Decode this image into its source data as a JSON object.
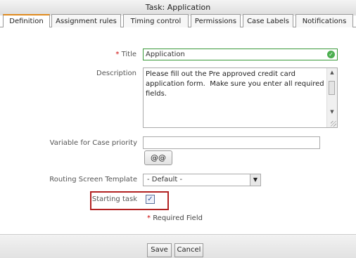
{
  "window": {
    "title": "Task: Application"
  },
  "tabs": [
    {
      "label": "Definition"
    },
    {
      "label": "Assignment rules"
    },
    {
      "label": "Timing control"
    },
    {
      "label": "Permissions"
    },
    {
      "label": "Case Labels"
    },
    {
      "label": "Notifications"
    }
  ],
  "form": {
    "title_label": "Title",
    "title_value": "Application",
    "description_label": "Description",
    "description_value": "Please fill out the Pre approved credit card application form.  Make sure you enter all required fields.",
    "variable_label": "Variable for Case priority",
    "variable_value": "",
    "variable_button": "@@",
    "routing_label": "Routing Screen Template",
    "routing_value": "- Default -",
    "starting_label": "Starting task",
    "starting_checked": true,
    "required_star": "*",
    "required_note": "Required Field"
  },
  "footer": {
    "save_label": "Save",
    "cancel_label": "Cancel"
  }
}
